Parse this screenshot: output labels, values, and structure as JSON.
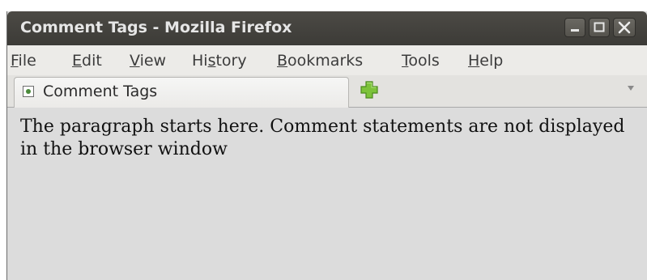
{
  "window": {
    "title": "Comment Tags - Mozilla Firefox",
    "controls": [
      "minimize-icon",
      "maximize-icon",
      "close-icon"
    ]
  },
  "menubar": {
    "items": [
      {
        "accel": "F",
        "rest": "ile"
      },
      {
        "accel": "E",
        "rest": "dit"
      },
      {
        "accel": "V",
        "rest": "iew"
      },
      {
        "pre": "Hi",
        "accel": "s",
        "rest": "tory"
      },
      {
        "accel": "B",
        "rest": "ookmarks"
      },
      {
        "accel": "T",
        "rest": "ools"
      },
      {
        "accel": "H",
        "rest": "elp"
      }
    ]
  },
  "tabs": {
    "active_label": "Comment Tags",
    "favicon": "page-icon",
    "new_tab_icon": "plus-icon",
    "list_icon": "chevron-down-icon"
  },
  "content": {
    "paragraph": "The paragraph starts here. Comment statements are not displayed in the browser window"
  },
  "colors": {
    "titlebar": "#3c3b37",
    "content_bg": "#dcdcdc",
    "new_tab_plus": "#7cc23a"
  }
}
